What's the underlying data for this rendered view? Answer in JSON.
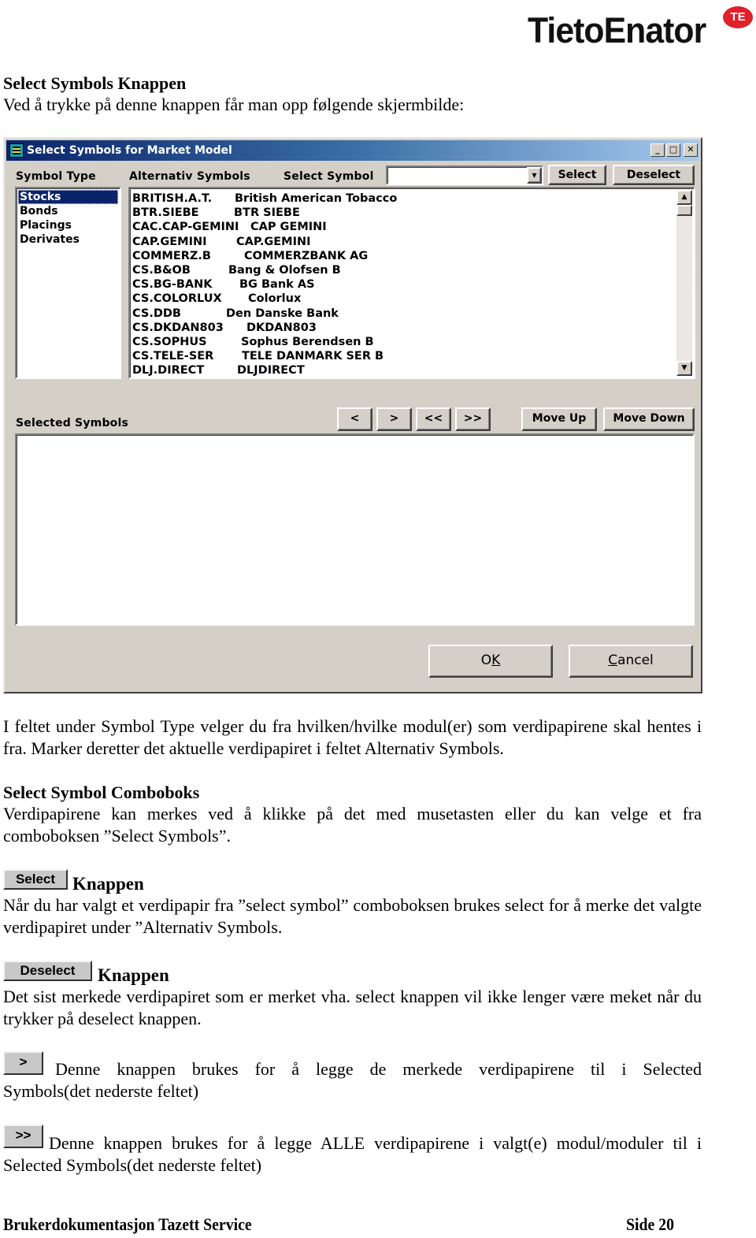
{
  "logo": {
    "text": "TietoEnator",
    "badge": "TE",
    "badge_color": "#e0202a"
  },
  "intro": {
    "heading": "Select Symbols Knappen",
    "text": "Ved å trykke på denne knappen får man opp følgende skjermbilde:"
  },
  "window": {
    "title": "Select Symbols for Market Model",
    "title_icon": "app-icon",
    "controls": {
      "minimize": "_",
      "maximize": "□",
      "close": "✕"
    },
    "symbol_type_label": "Symbol Type",
    "alternativ_label": "Alternativ Symbols",
    "select_symbol_label": "Select Symbol",
    "select_symbol_value": "",
    "dropdown_arrow": "▾",
    "select_button": "Select",
    "deselect_button": "Deselect",
    "symbol_types": [
      {
        "label": "Stocks",
        "selected": true
      },
      {
        "label": "Bonds",
        "selected": false
      },
      {
        "label": "Placings",
        "selected": false
      },
      {
        "label": "Derivates",
        "selected": false
      }
    ],
    "symbols": [
      {
        "code": "BRITISH.A.T.",
        "name": "British American Tobacco"
      },
      {
        "code": "BTR.SIEBE",
        "name": "BTR SIEBE"
      },
      {
        "code": "CAC.CAP-GEMINI",
        "name": "CAP GEMINI"
      },
      {
        "code": "CAP.GEMINI",
        "name": "CAP.GEMINI"
      },
      {
        "code": "COMMERZ.B",
        "name": "COMMERZBANK AG"
      },
      {
        "code": "CS.B&OB",
        "name": "Bang & Olofsen B"
      },
      {
        "code": "CS.BG-BANK",
        "name": "BG Bank AS"
      },
      {
        "code": "CS.COLORLUX",
        "name": "Colorlux"
      },
      {
        "code": "CS.DDB",
        "name": "Den Danske Bank"
      },
      {
        "code": "CS.DKDAN803",
        "name": "DKDAN803"
      },
      {
        "code": "CS.SOPHUS",
        "name": "Sophus Berendsen B"
      },
      {
        "code": "CS.TELE-SER",
        "name": "TELE DANMARK SER B"
      },
      {
        "code": "DLJ.DIRECT",
        "name": "DLJDIRECT"
      }
    ],
    "scroll_up": "▲",
    "scroll_down": "▼",
    "selected_symbols_label": "Selected Symbols",
    "remove_one": "<",
    "add_one": ">",
    "remove_all": "<<",
    "add_all": ">>",
    "move_up": "Move Up",
    "move_down": "Move Down",
    "selected_symbols": [],
    "ok_button": {
      "pre": "O",
      "accel": "K",
      "post": ""
    },
    "cancel_button": {
      "pre": "",
      "accel": "C",
      "post": "ancel"
    }
  },
  "paragraphs": {
    "symbol_type_text": "I feltet under Symbol Type velger du fra hvilken/hvilke modul(er) som verdipapirene skal hentes i fra. Marker deretter det aktuelle verdipapiret i feltet Alternativ Symbols.",
    "combo_heading": "Select Symbol Comboboks",
    "combo_text": "Verdipapirene kan merkes ved å klikke på det med musetasten eller du kan velge et fra comboboksen ”Select Symbols”.",
    "select_btn_label": "Select",
    "select_heading": "Knappen",
    "select_text": "Når du har valgt et verdipapir fra ”select symbol” comboboksen brukes select for å merke det valgte verdipapiret under ”Alternativ Symbols.",
    "deselect_btn_label": "Deselect",
    "deselect_heading": "Knappen",
    "deselect_text": "Det sist merkede verdipapiret som er merket vha. select knappen vil ikke lenger være meket når du trykker på deselect knappen.",
    "add_btn_label": ">",
    "add_text_line1": "Denne knappen brukes for å legge de merkede verdipapirene til i Selected",
    "add_text_line2": "Symbols(det nederste feltet)",
    "addall_btn_label": ">>",
    "addall_text_line1": "Denne knappen brukes for å legge ALLE verdipapirene i valgt(e) modul/moduler til i",
    "addall_text_line2": "Selected Symbols(det nederste feltet)"
  },
  "footer": {
    "left": "Brukerdokumentasjon Tazett Service",
    "right": "Side 20"
  }
}
